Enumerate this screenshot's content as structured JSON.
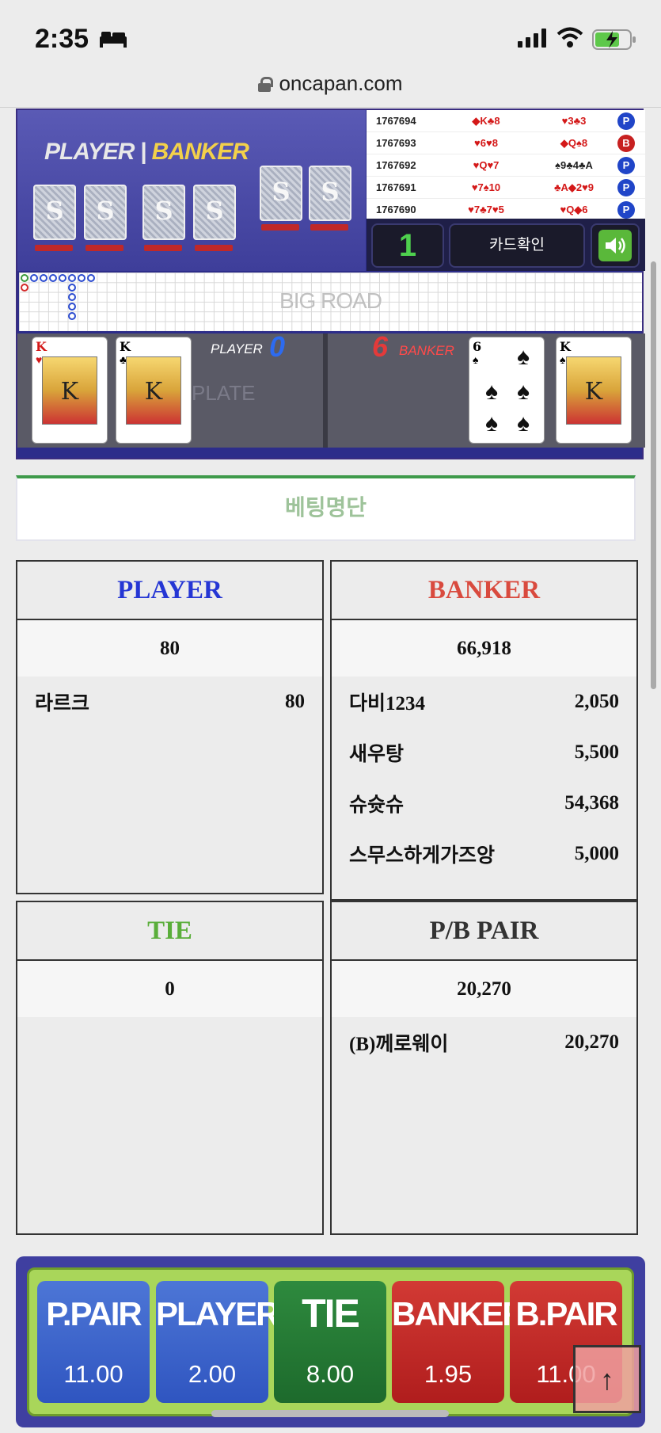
{
  "status": {
    "time": "2:35"
  },
  "browser": {
    "url": "oncapan.com"
  },
  "video": {
    "player_label": "PLAYER",
    "divider": "|",
    "banker_label": "BANKER"
  },
  "history": [
    {
      "id": "1767694",
      "player": "◆K♣8",
      "banker": "♥3♣3",
      "result": "P"
    },
    {
      "id": "1767693",
      "player": "♥6♥8",
      "banker": "◆Q♠8",
      "result": "B"
    },
    {
      "id": "1767692",
      "player": "♥Q♥7",
      "banker": "♠9♣4♣A",
      "result": "P"
    },
    {
      "id": "1767691",
      "player": "♥7♠10",
      "banker": "♣A◆2♥9",
      "result": "P"
    },
    {
      "id": "1767690",
      "player": "♥7♣7♥5",
      "banker": "♥Q◆6",
      "result": "P"
    }
  ],
  "controls": {
    "round": "1",
    "card_check": "카드확인"
  },
  "bigroad": {
    "label": "BIG ROAD"
  },
  "table": {
    "player_label": "PLAYER",
    "player_score": "0",
    "banker_label": "BANKER",
    "banker_score": "6",
    "plate": "PLATE",
    "player_cards": [
      {
        "rank": "K",
        "suit": "♥"
      },
      {
        "rank": "K",
        "suit": "♣"
      }
    ],
    "banker_cards": [
      {
        "rank": "6",
        "suit": "♠"
      },
      {
        "rank": "K",
        "suit": "♠"
      }
    ]
  },
  "bet_list": {
    "title": "베팅명단",
    "player": {
      "title": "PLAYER",
      "total": "80",
      "entries": [
        {
          "name": "라르크",
          "amount": "80"
        }
      ]
    },
    "banker": {
      "title": "BANKER",
      "total": "66,918",
      "entries": [
        {
          "name": "다비1234",
          "amount": "2,050"
        },
        {
          "name": "새우탕",
          "amount": "5,500"
        },
        {
          "name": "슈슛슈",
          "amount": "54,368"
        },
        {
          "name": "스무스하게가즈앙",
          "amount": "5,000"
        }
      ]
    },
    "tie": {
      "title": "TIE",
      "total": "0",
      "entries": []
    },
    "pair": {
      "title": "P/B PAIR",
      "total": "20,270",
      "entries": [
        {
          "name": "(B)께로웨이",
          "amount": "20,270"
        }
      ]
    }
  },
  "bet_buttons": [
    {
      "name": "P.PAIR",
      "odds": "11.00"
    },
    {
      "name": "PLAYER",
      "odds": "2.00"
    },
    {
      "name": "TIE",
      "odds": "8.00"
    },
    {
      "name": "BANKER",
      "odds": "1.95"
    },
    {
      "name": "B.PAIR",
      "odds": "11.00"
    }
  ],
  "colors": {
    "player": "#2536d4",
    "banker": "#d94a3e",
    "tie": "#5aae3a",
    "pair": "#333333"
  },
  "icons": {
    "to_top": "arrow-up-icon",
    "sound": "speaker-icon",
    "lock": "lock-icon"
  }
}
